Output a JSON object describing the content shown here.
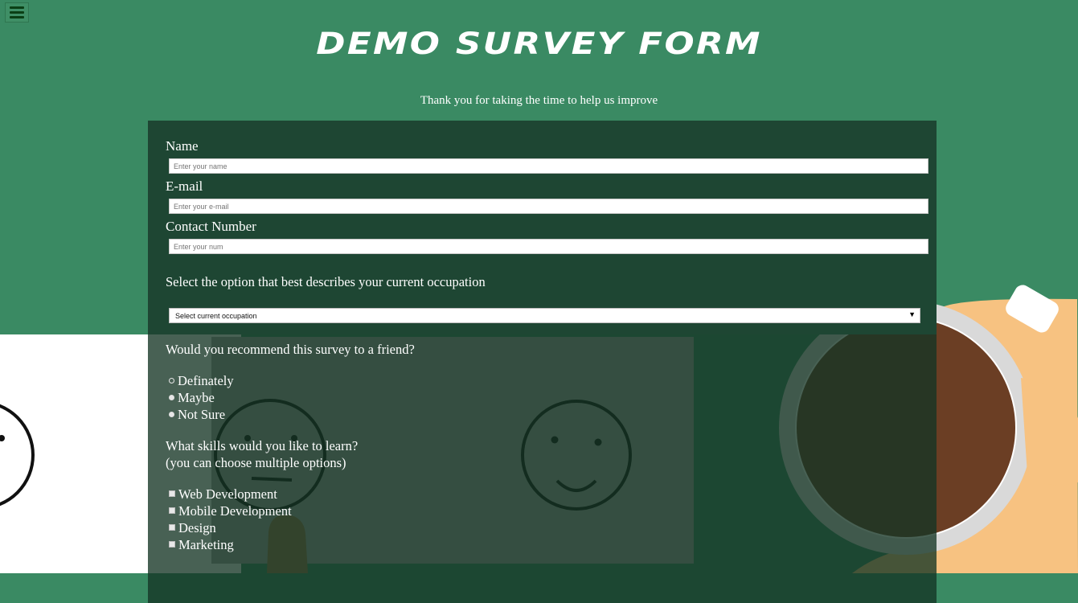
{
  "header": {
    "menu_icon": "hamburger-menu-icon",
    "title": "DEMO SURVEY FORM",
    "subtitle": "Thank you for taking the time to help us improve"
  },
  "colors": {
    "background": "#3a8a63",
    "panel": "#1e4633",
    "text": "#ffffff"
  },
  "form": {
    "name": {
      "label": "Name",
      "placeholder": "Enter your name",
      "value": ""
    },
    "email": {
      "label": "E-mail",
      "placeholder": "Enter your e-mail",
      "value": ""
    },
    "contact": {
      "label": "Contact Number",
      "placeholder": "Enter your num",
      "value": ""
    },
    "occupation": {
      "label": "Select the option that best describes your current occupation",
      "selected": "Select current occupation"
    },
    "recommend": {
      "label": "Would you recommend this survey to a friend?",
      "options": [
        {
          "label": "Definately",
          "checked": false
        },
        {
          "label": "Maybe",
          "checked": false
        },
        {
          "label": "Not Sure",
          "checked": false
        }
      ]
    },
    "skills": {
      "label": "What skills would you like to learn?",
      "hint": "(you can choose multiple options)",
      "options": [
        {
          "label": "Web Development",
          "checked": false
        },
        {
          "label": "Mobile Development",
          "checked": false
        },
        {
          "label": "Design",
          "checked": false
        },
        {
          "label": "Marketing",
          "checked": false
        }
      ]
    }
  }
}
